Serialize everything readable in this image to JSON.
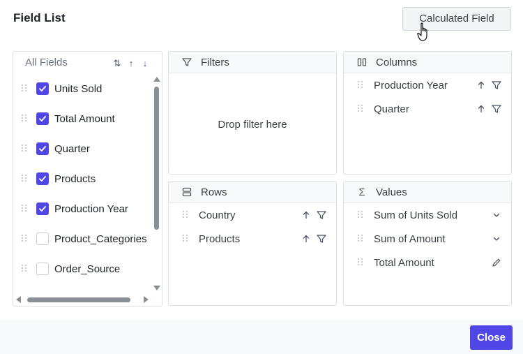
{
  "dialog": {
    "title": "Field List",
    "calculated_field_label": "Calculated Field",
    "close_label": "Close"
  },
  "all_fields": {
    "label": "All Fields",
    "sort_icons": [
      "sort-toggle-icon",
      "sort-ascending-icon",
      "sort-descending-icon"
    ],
    "items": [
      {
        "label": "Units Sold",
        "checked": true
      },
      {
        "label": "Total Amount",
        "checked": true
      },
      {
        "label": "Quarter",
        "checked": true
      },
      {
        "label": "Products",
        "checked": true
      },
      {
        "label": "Production Year",
        "checked": true
      },
      {
        "label": "Product_Categories",
        "checked": false
      },
      {
        "label": "Order_Source",
        "checked": false
      }
    ]
  },
  "filters": {
    "label": "Filters",
    "icon": "filter-icon",
    "placeholder": "Drop filter here"
  },
  "columns": {
    "label": "Columns",
    "icon": "columns-icon",
    "items": [
      {
        "label": "Production Year"
      },
      {
        "label": "Quarter"
      }
    ]
  },
  "rows": {
    "label": "Rows",
    "icon": "rows-icon",
    "items": [
      {
        "label": "Country"
      },
      {
        "label": "Products"
      }
    ]
  },
  "values": {
    "label": "Values",
    "icon": "sigma-icon",
    "items": [
      {
        "label": "Sum of Units Sold",
        "action": "chevron-down-icon"
      },
      {
        "label": "Sum of Amount",
        "action": "chevron-down-icon"
      },
      {
        "label": "Total Amount",
        "action": "edit-icon"
      }
    ]
  },
  "colors": {
    "accent": "#4f46e5",
    "header_bg": "#f8f9fa",
    "border": "#dee2e6"
  }
}
